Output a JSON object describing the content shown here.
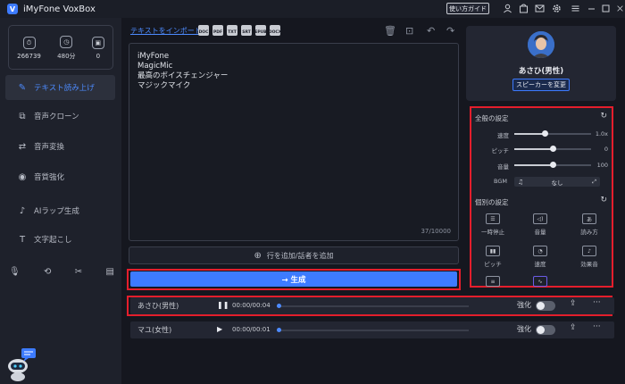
{
  "app": {
    "title": "iMyFone VoxBox",
    "logo_letter": "V"
  },
  "titlebar": {
    "guide_label": "使い方ガイド"
  },
  "stats": [
    {
      "icon": "character-count-icon",
      "value": "266739"
    },
    {
      "icon": "time-minutes-icon",
      "value": "480分"
    },
    {
      "icon": "clone-count-icon",
      "value": "0"
    }
  ],
  "nav": [
    {
      "label": "テキスト読み上げ",
      "icon": "text-to-speech-icon",
      "active": true
    },
    {
      "label": "音声クローン",
      "icon": "voice-clone-icon"
    },
    {
      "label": "音声変換",
      "icon": "voice-convert-icon"
    },
    {
      "label": "音質強化",
      "icon": "audio-enhance-icon"
    },
    {
      "label": "AIラップ生成",
      "icon": "ai-rap-icon"
    },
    {
      "label": "文字起こし",
      "icon": "transcribe-icon"
    }
  ],
  "editor": {
    "import_label": "テキストをインポート",
    "lines": [
      "iMyFone",
      "MagicMic",
      "最高のボイスチェンジャー",
      "マジックマイク"
    ],
    "char_count": "37/10000",
    "add_line_label": "行を追加/話者を追加",
    "formats": [
      "DOC",
      "PDF",
      "TXT",
      "SRT",
      "EPUB",
      "DOCX"
    ]
  },
  "generate_label": "→ 生成",
  "speaker": {
    "name": "あさひ(男性)",
    "change_label": "スピーカーを変更"
  },
  "settings": {
    "global_title": "全般の設定",
    "sliders": [
      {
        "label": "速度",
        "value": "1.0x",
        "fraction": 0.4
      },
      {
        "label": "ピッチ",
        "value": "0",
        "fraction": 0.5
      },
      {
        "label": "音量",
        "value": "100",
        "fraction": 0.5
      }
    ],
    "bgm_label": "BGM",
    "bgm_value": "なし",
    "individual_title": "個別の設定",
    "effects": [
      "一時停止",
      "音量",
      "読み方",
      "ピッチ",
      "速度",
      "効果音"
    ]
  },
  "tracks": [
    {
      "name": "あさひ(男性)",
      "play_icon": "pause-icon",
      "play_glyph": "❚❚",
      "time": "00:00/00:04",
      "enhance_label": "強化"
    },
    {
      "name": "マユ(女性)",
      "play_icon": "play-icon",
      "play_glyph": "▶",
      "time": "00:00/00:01",
      "enhance_label": "強化"
    }
  ]
}
